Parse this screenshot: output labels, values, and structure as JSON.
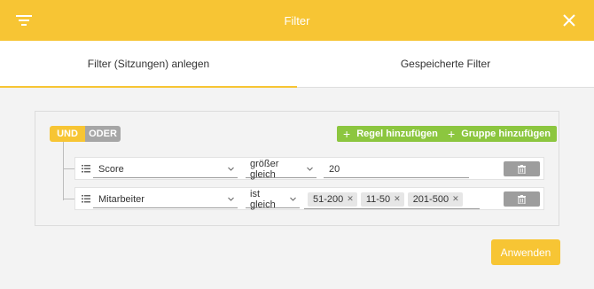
{
  "header": {
    "title": "Filter",
    "bg_color": "#f7c534",
    "left_icon": "filter-list-icon",
    "right_icon": "close-icon"
  },
  "tabs": [
    {
      "label": "Filter (Sitzungen) anlegen",
      "active": true
    },
    {
      "label": "Gespeicherte Filter",
      "active": false
    }
  ],
  "builder": {
    "conjunctions": {
      "und": "UND",
      "oder": "ODER",
      "selected": "UND"
    },
    "add_rule_label": "Regel hinzufügen",
    "add_group_label": "Gruppe hinzufügen",
    "rules": [
      {
        "field": "Score",
        "operator": "größer gleich",
        "value": "20"
      },
      {
        "field": "Mitarbeiter",
        "operator": "ist gleich",
        "tags": [
          "51-200",
          "11-50",
          "201-500"
        ]
      }
    ]
  },
  "apply_label": "Anwenden",
  "colors": {
    "accent": "#f7c534",
    "green": "#8cc63f",
    "gray": "#a6a6a6"
  }
}
